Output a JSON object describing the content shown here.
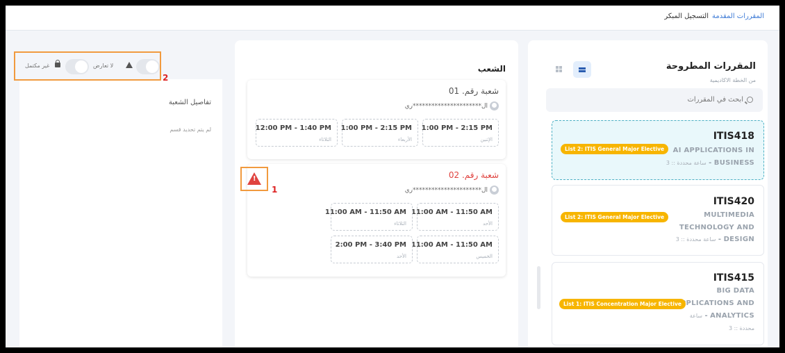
{
  "tabs": {
    "offered": "المقررات المقدمة",
    "early": "التسجيل المبكر"
  },
  "offered_courses": {
    "title": "المقررات المطروحة",
    "subtitle": "من الخطة الاكاديمية",
    "search_placeholder": "ابحث في المقررات",
    "courses": [
      {
        "code": "ITIS418",
        "lines": [
          "AI APPLICATIONS IN",
          "BUSINESS"
        ],
        "meta_suffix": "ساعة محددة :: 3",
        "badge": "List 2: ITIS General Major Elective"
      },
      {
        "code": "ITIS420",
        "lines": [
          "MULTIMEDIA",
          "TECHNOLOGY AND",
          "DESIGN"
        ],
        "meta_suffix": "ساعة محددة :: 3",
        "badge": "List 2: ITIS General Major Elective"
      },
      {
        "code": "ITIS415",
        "lines": [
          "BIG DATA",
          "APPLICATIONS AND",
          "ANALYTICS"
        ],
        "meta_suffix": "ساعة",
        "meta_extra": "محددة :: 3",
        "badge": "List 1: ITIS Concentration Major Elective"
      }
    ]
  },
  "sections": {
    "title": "الشعب",
    "items": [
      {
        "title": "شعبة رقم. 01",
        "instructor": "ال**********************ري",
        "slots": [
          {
            "time": "1:00 PM - 2:15 PM",
            "day": "الإثنين"
          },
          {
            "time": "1:00 PM - 2:15 PM",
            "day": "الأربعاء"
          },
          {
            "time": "12:00 PM - 1:40 PM",
            "day": "الثلاثاء"
          }
        ]
      },
      {
        "title": "شعبة رقم. 02",
        "instructor": "ال**********************ري",
        "slots": [
          {
            "time": "11:00 AM - 11:50 AM",
            "day": "الأحد"
          },
          {
            "time": "11:00 AM - 11:50 AM",
            "day": "الثلاثاء"
          },
          {
            "time": "11:00 AM - 11:50 AM",
            "day": "الخميس"
          },
          {
            "time": "2:00 PM - 3:40 PM",
            "day": "الأحد"
          }
        ]
      }
    ]
  },
  "filters": {
    "no_conflict": "لا تعارض",
    "incomplete": "غير مكتمل"
  },
  "section_details": {
    "title": "تفاصيل الشعبة",
    "empty": "لم يتم تحديد قسم"
  },
  "annotations": {
    "warning_number": "1",
    "toggles_number": "2"
  },
  "colors": {
    "accent": "#3e7bd6",
    "badge": "#f7b500",
    "alert": "#e0433f",
    "highlight": "#f19a3e"
  }
}
